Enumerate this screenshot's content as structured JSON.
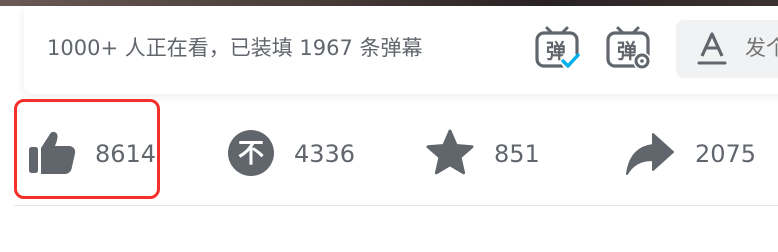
{
  "danmaku_bar": {
    "viewer_text": "1000+ 人正在看，已装填 1967 条弹幕",
    "toggle_icon_label": "弹",
    "settings_icon_label": "弹",
    "send_placeholder": "发个"
  },
  "actions": {
    "like_count": "8614",
    "coin_count": "4336",
    "coin_icon_label": "不",
    "favorite_count": "851",
    "share_count": "2075"
  },
  "colors": {
    "icon_gray": "#61666d",
    "accent_blue": "#00aeec",
    "highlight_red": "#f5302b"
  }
}
